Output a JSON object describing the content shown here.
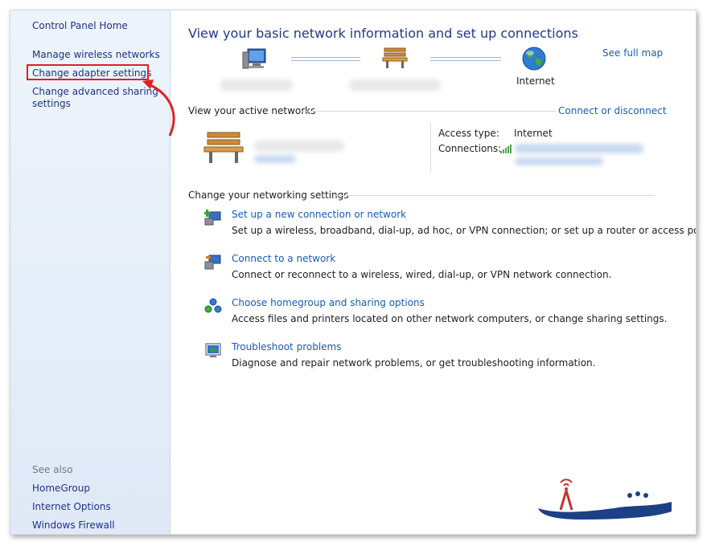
{
  "left_pane": {
    "home": "Control Panel Home",
    "links": [
      "Manage wireless networks",
      "Change adapter settings",
      "Change advanced sharing",
      "settings"
    ],
    "see_also_label": "See also",
    "see_also": [
      "HomeGroup",
      "Internet Options",
      "Windows Firewall"
    ]
  },
  "main": {
    "title": "View your basic network information and set up connections",
    "see_full_map": "See full map",
    "internet_label": "Internet",
    "active_networks_label": "View your active networks",
    "connect_disconnect": "Connect or disconnect",
    "access_type_label": "Access type:",
    "access_type_value": "Internet",
    "connections_label": "Connections:",
    "change_settings_label": "Change your networking settings",
    "tasks": [
      {
        "title": "Set up a new connection or network",
        "desc": "Set up a wireless, broadband, dial-up, ad hoc, or VPN connection; or set up a router or access point."
      },
      {
        "title": "Connect to a network",
        "desc": "Connect or reconnect to a wireless, wired, dial-up, or VPN network connection."
      },
      {
        "title": "Choose homegroup and sharing options",
        "desc": "Access files and printers located on other network computers, or change sharing settings."
      },
      {
        "title": "Troubleshoot problems",
        "desc": "Diagnose and repair network problems, or get troubleshooting information."
      }
    ]
  },
  "colors": {
    "link": "#1a5bb5",
    "title": "#1e3a8c",
    "highlight": "#e02020"
  }
}
